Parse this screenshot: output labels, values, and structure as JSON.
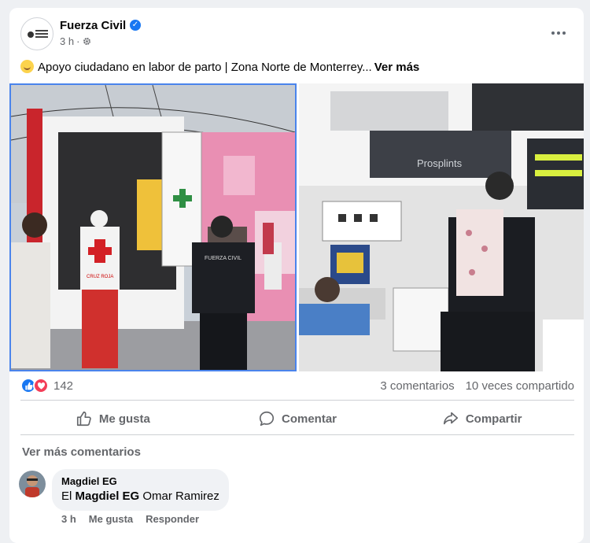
{
  "post": {
    "page_name": "Fuerza Civil",
    "time": "3 h",
    "separator": "·",
    "text": "Apoyo ciudadano en labor de parto | Zona Norte de Monterrey...",
    "see_more": "Ver más",
    "reactions_count": "142",
    "comments_count": "3 comentarios",
    "shares_count": "10 veces compartido"
  },
  "actions": {
    "like": "Me gusta",
    "comment": "Comentar",
    "share": "Compartir"
  },
  "comments_section": {
    "view_more": "Ver más comentarios",
    "items": [
      {
        "author": "Magdiel EG",
        "prefix": "El",
        "mention": "Magdiel EG",
        "rest": "Omar Ramirez",
        "time": "3 h",
        "like": "Me gusta",
        "reply": "Responder"
      }
    ]
  },
  "photos": {
    "left_texts": {
      "cross_label_1": "CRUZ ROJA",
      "vest_label": "FUERZA CIVIL"
    },
    "right_texts": {
      "brand": "Prosplints"
    }
  },
  "colors": {
    "accent_blue": "#1877f2",
    "love_red": "#f33e58",
    "secondary_text": "#65676b"
  },
  "icons": {
    "verified": "verified-badge-icon",
    "audience": "gear-icon",
    "more": "more-options-icon",
    "like": "thumbs-up-icon",
    "comment": "comment-bubble-icon",
    "share": "share-arrow-icon"
  }
}
